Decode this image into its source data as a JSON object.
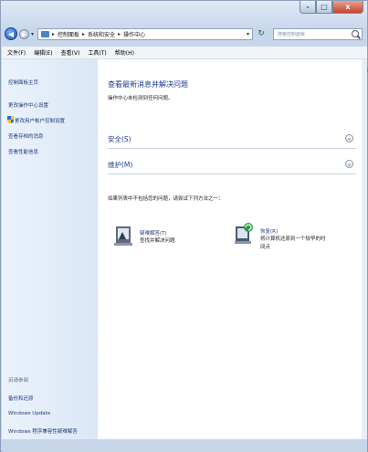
{
  "window": {
    "caption_buttons": {
      "minimize": "-",
      "maximize": "□",
      "close": "x"
    }
  },
  "navigation": {
    "back_icon": "back-arrow-icon",
    "forward_icon": "forward-arrow-icon",
    "breadcrumbs": [
      "控制面板",
      "系统和安全",
      "操作中心"
    ],
    "search_placeholder": "搜索控制面板"
  },
  "menubar": {
    "items": [
      "文件(F)",
      "编辑(E)",
      "查看(V)",
      "工具(T)",
      "帮助(H)"
    ]
  },
  "left_pane": {
    "home_link": "控制面板主页",
    "links": [
      "更改操作中心设置",
      "更改用户帐户控制设置",
      "查看存档的消息",
      "查看性能信息"
    ],
    "see_also_title": "另请参阅",
    "see_also_links": [
      "备份和还原",
      "Windows Update",
      "Windows 程序兼容性疑难解答"
    ]
  },
  "main": {
    "title": "查看最新消息并解决问题",
    "subtitle": "操作中心未检测到任何问题。",
    "sections": [
      {
        "label": "安全(S)",
        "icon": "chevron-down-icon"
      },
      {
        "label": "维护(M)",
        "icon": "chevron-down-icon"
      }
    ],
    "prompt": "如果列表中不包括您的问题，请尝试下列方法之一：",
    "tools": [
      {
        "link": "疑难解答(T)",
        "desc": [
          "查找并解决问题"
        ]
      },
      {
        "link": "恢复(R)",
        "desc": [
          "将计算机还原到一个较早的时",
          "间点"
        ]
      }
    ]
  }
}
